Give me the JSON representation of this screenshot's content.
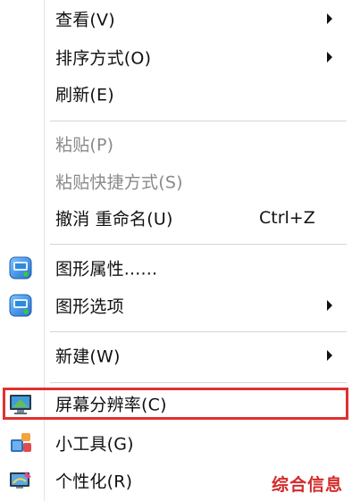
{
  "menu": {
    "items": [
      {
        "label": "查看(V)",
        "submenu": true
      },
      {
        "label": "排序方式(O)",
        "submenu": true
      },
      {
        "label": "刷新(E)"
      },
      {
        "label": "粘贴(P)",
        "disabled": true
      },
      {
        "label": "粘贴快捷方式(S)",
        "disabled": true
      },
      {
        "label": "撤消 重命名(U)",
        "shortcut": "Ctrl+Z"
      },
      {
        "label": "图形属性......",
        "icon": "intel-graphics-icon"
      },
      {
        "label": "图形选项",
        "icon": "intel-graphics-icon",
        "submenu": true
      },
      {
        "label": "新建(W)",
        "submenu": true
      },
      {
        "label": "屏幕分辨率(C)",
        "icon": "monitor-icon",
        "highlighted": true
      },
      {
        "label": "小工具(G)",
        "icon": "gadgets-icon"
      },
      {
        "label": "个性化(R)",
        "icon": "personalize-icon"
      }
    ]
  },
  "watermark": "综合信息",
  "colors": {
    "highlight_border": "#e0312f",
    "disabled_text": "#8a8a8a",
    "watermark": "#d32a2a"
  }
}
